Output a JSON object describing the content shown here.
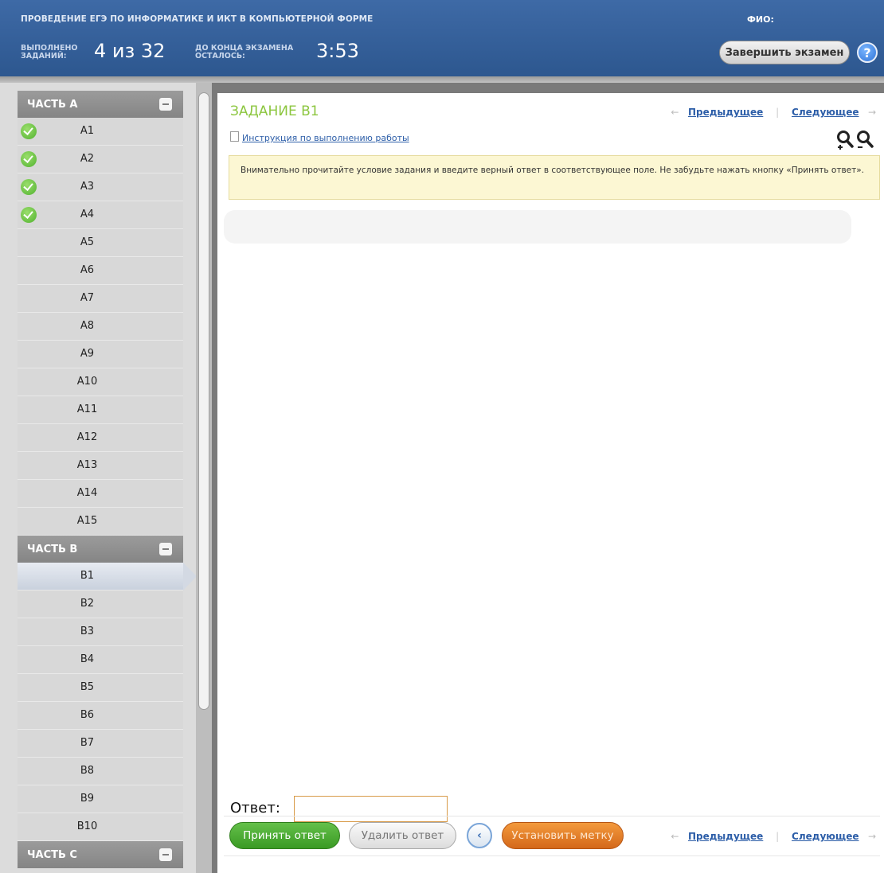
{
  "header": {
    "title": "ПРОВЕДЕНИЕ ЕГЭ ПО ИНФОРМАТИКЕ И ИКТ В КОМПЬЮТЕРНОЙ ФОРМЕ",
    "fio_label": "ФИО:",
    "done_label_1": "ВЫПОЛНЕНО",
    "done_label_2": "ЗАДАНИЙ:",
    "done_value": "4 из 32",
    "time_label_1": "ДО КОНЦА ЭКЗАМЕНА",
    "time_label_2": "ОСТАЛОСЬ:",
    "time_value": "3:53",
    "finish_button": "Завершить экзамен",
    "help": "?"
  },
  "sidebar": {
    "part_a": "ЧАСТЬ А",
    "part_b": "ЧАСТЬ В",
    "part_c": "ЧАСТЬ С",
    "part_a_items": [
      {
        "label": "A1",
        "done": true
      },
      {
        "label": "A2",
        "done": true
      },
      {
        "label": "A3",
        "done": true
      },
      {
        "label": "A4",
        "done": true
      },
      {
        "label": "A5",
        "done": false
      },
      {
        "label": "A6",
        "done": false
      },
      {
        "label": "A7",
        "done": false
      },
      {
        "label": "A8",
        "done": false
      },
      {
        "label": "A9",
        "done": false
      },
      {
        "label": "A10",
        "done": false
      },
      {
        "label": "A11",
        "done": false
      },
      {
        "label": "A12",
        "done": false
      },
      {
        "label": "A13",
        "done": false
      },
      {
        "label": "A14",
        "done": false
      },
      {
        "label": "A15",
        "done": false
      }
    ],
    "part_b_items": [
      {
        "label": "B1",
        "active": true
      },
      {
        "label": "B2"
      },
      {
        "label": "B3"
      },
      {
        "label": "B4"
      },
      {
        "label": "B5"
      },
      {
        "label": "B6"
      },
      {
        "label": "B7"
      },
      {
        "label": "B8"
      },
      {
        "label": "B9"
      },
      {
        "label": "B10"
      }
    ]
  },
  "main": {
    "task_title": "ЗАДАНИЕ В1",
    "prev": "Предыдущее",
    "next": "Следующее",
    "arrow_left": "←",
    "arrow_right": "→",
    "separator": "|",
    "instruction_link": "Инструкция по выполнению работы",
    "notice": "Внимательно прочитайте условие задания и введите верный ответ в соответствующее поле. Не забудьте нажать кнопку «Принять ответ».",
    "answer_label": "Ответ:",
    "answer_value": "",
    "accept_button": "Принять ответ",
    "delete_button": "Удалить ответ",
    "back_symbol": "‹",
    "mark_button": "Установить метку"
  }
}
